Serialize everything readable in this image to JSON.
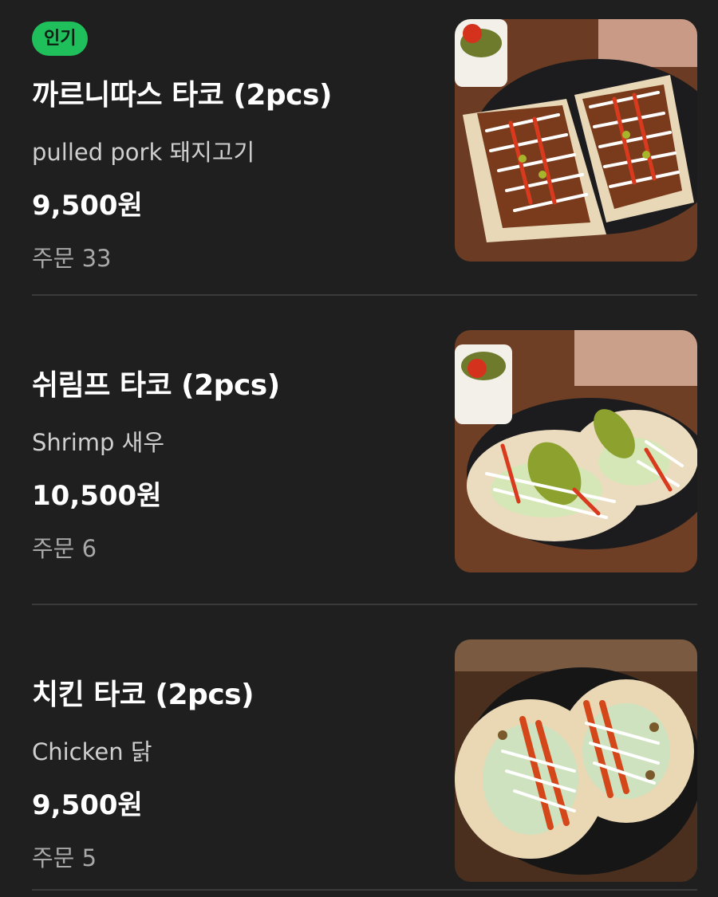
{
  "menu": {
    "items": [
      {
        "badge": "인기",
        "name": "까르니따스 타코 (2pcs)",
        "description": "pulled pork 돼지고기",
        "price": "9,500원",
        "orders": "주문 33"
      },
      {
        "badge": "",
        "name": "쉬림프 타코 (2pcs)",
        "description": "Shrimp 새우",
        "price": "10,500원",
        "orders": "주문 6"
      },
      {
        "badge": "",
        "name": "치킨 타코 (2pcs)",
        "description": "Chicken 닭",
        "price": "9,500원",
        "orders": "주문 5"
      }
    ]
  },
  "colors": {
    "background": "#1f1f1f",
    "badge": "#1fbf5b",
    "divider": "#3a3a3a"
  }
}
